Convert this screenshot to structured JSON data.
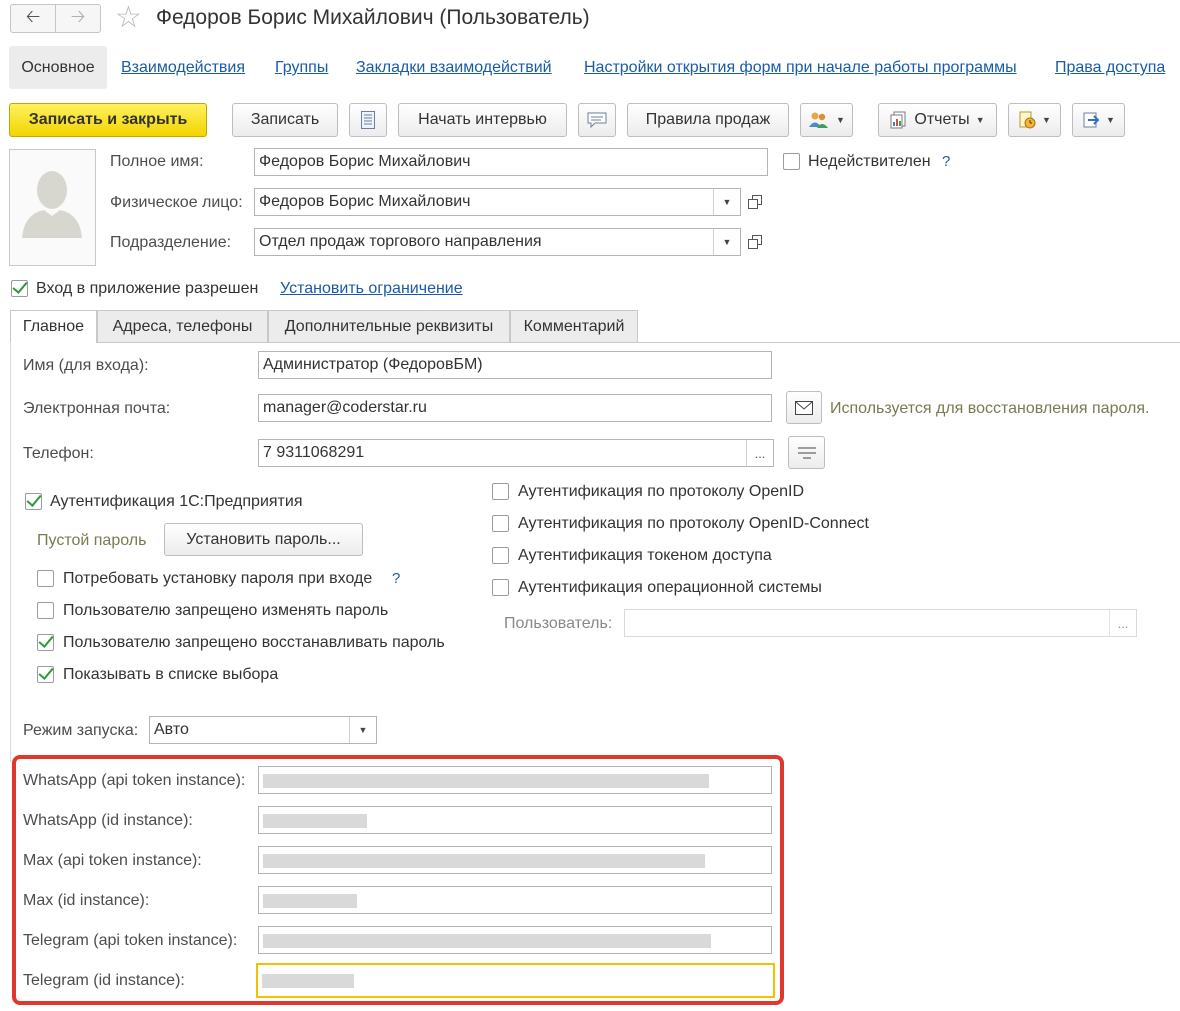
{
  "window": {
    "title": "Федоров Борис Михайлович (Пользователь)",
    "back_icon": "arrow-left-icon",
    "forward_icon": "arrow-right-icon",
    "favorite_icon": "star-icon"
  },
  "sections": {
    "active": "Основное",
    "links": [
      "Взаимодействия",
      "Группы",
      "Закладки взаимодействий",
      "Настройки открытия форм при начале работы программы",
      "Права доступа"
    ]
  },
  "toolbar": {
    "save_close": "Записать и закрыть",
    "save": "Записать",
    "interview": "Начать интервью",
    "sales_rules": "Правила продаж",
    "reports": "Отчеты"
  },
  "header": {
    "full_name_label": "Полное имя:",
    "full_name_value": "Федоров Борис Михайлович",
    "person_label": "Физическое лицо:",
    "person_value": "Федоров Борис Михайлович",
    "division_label": "Подразделение:",
    "division_value": "Отдел продаж торгового направления",
    "invalid_label": "Недействителен",
    "login_allowed_label": "Вход в приложение разрешен",
    "set_restriction_link": "Установить ограничение"
  },
  "tabs": [
    "Главное",
    "Адреса, телефоны",
    "Дополнительные реквизиты",
    "Комментарий"
  ],
  "main": {
    "login_name_label": "Имя (для входа):",
    "login_name_value": "Администратор (ФедоровБМ)",
    "email_label": "Электронная почта:",
    "email_value": "manager@coderstar.ru",
    "email_hint": "Используется для восстановления пароля.",
    "phone_label": "Телефон:",
    "phone_value": "7 9311068291",
    "auth_1c_label": "Аутентификация 1С:Предприятия",
    "empty_password": "Пустой пароль",
    "set_password_button": "Установить пароль...",
    "require_password_change": "Потребовать установку пароля при входе",
    "forbid_change_password": "Пользователю запрещено изменять пароль",
    "forbid_restore_password": "Пользователю запрещено восстанавливать пароль",
    "show_in_list": "Показывать в списке выбора",
    "auth_openid": "Аутентификация по протоколу OpenID",
    "auth_openid_connect": "Аутентификация по протоколу OpenID-Connect",
    "auth_token": "Аутентификация токеном доступа",
    "auth_os": "Аутентификация операционной системы",
    "os_user_label": "Пользователь:",
    "launch_mode_label": "Режим запуска:",
    "launch_mode_value": "Авто"
  },
  "messengers": {
    "whatsapp_token_label": "WhatsApp (api token instance):",
    "whatsapp_id_label": "WhatsApp (id instance):",
    "max_token_label": "Max (api token instance):",
    "max_id_label": "Max (id instance):",
    "telegram_token_label": "Telegram (api token instance):",
    "telegram_id_label": "Telegram (id instance):"
  },
  "colors": {
    "primary_button": "#f5d800",
    "link": "#1a5ba8",
    "check": "#2a9a3a",
    "highlight_border": "#e0382f",
    "focus_border": "#f2c200"
  }
}
